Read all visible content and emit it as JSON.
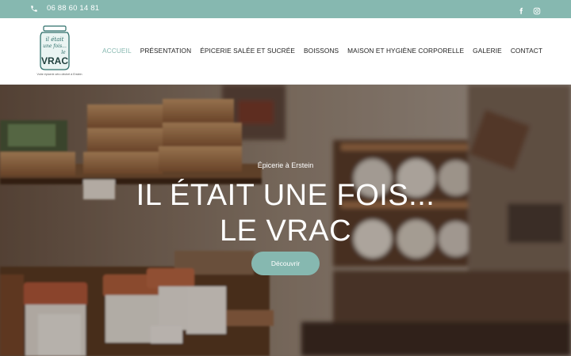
{
  "topbar": {
    "phone": "06 88 60 14 81",
    "icons": [
      "phone-icon",
      "facebook-icon",
      "instagram-icon"
    ]
  },
  "logo": {
    "line1": "il était",
    "line2": "une fois...",
    "line3": "le",
    "line4": "VRAC",
    "tagline": "Votre épicerie zéro déchet à Erstein"
  },
  "nav": {
    "items": [
      {
        "label": "ACCUEIL",
        "active": true
      },
      {
        "label": "PRÉSENTATION"
      },
      {
        "label": "ÉPICERIE SALÉE ET SUCRÉE"
      },
      {
        "label": "BOISSONS"
      },
      {
        "label": "MAISON ET HYGIÈNE CORPORELLE"
      },
      {
        "label": "GALERIE"
      },
      {
        "label": "CONTACT"
      }
    ]
  },
  "hero": {
    "subtitle": "Épicerie à Erstein",
    "title_line1": "IL ÉTAIT UNE FOIS...",
    "title_line2": "LE VRAC",
    "button": "Découvrir"
  },
  "colors": {
    "accent": "#86b8b0",
    "text": "#222222"
  }
}
